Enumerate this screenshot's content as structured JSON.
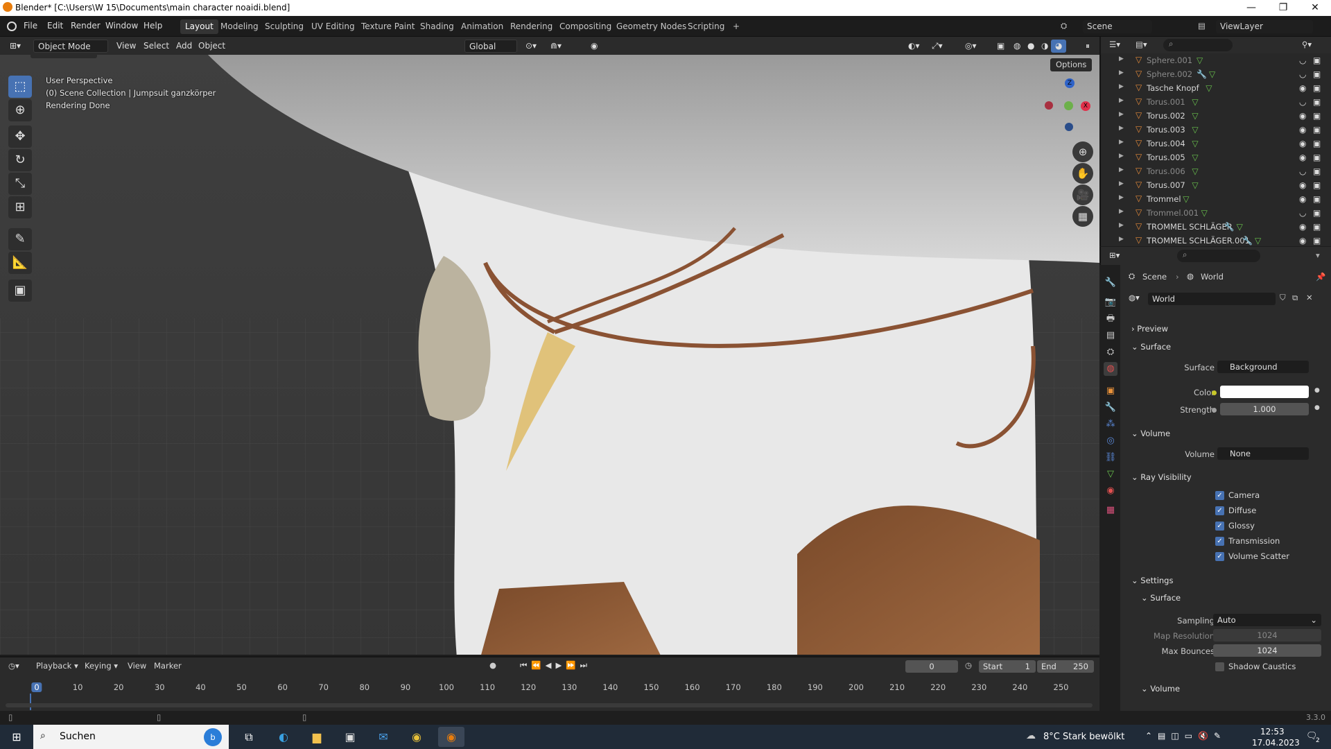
{
  "window": {
    "title": "Blender* [C:\\Users\\W 15\\Documents\\main character noaidi.blend]",
    "minimize": "—",
    "maximize": "❐",
    "close": "✕"
  },
  "menu": {
    "items": [
      "File",
      "Edit",
      "Render",
      "Window",
      "Help"
    ],
    "workspaces": [
      "Layout",
      "Modeling",
      "Sculpting",
      "UV Editing",
      "Texture Paint",
      "Shading",
      "Animation",
      "Rendering",
      "Compositing",
      "Geometry Nodes",
      "Scripting"
    ],
    "add_workspace": "+",
    "scene": "Scene",
    "view_layer": "ViewLayer"
  },
  "viewport_header": {
    "mode": "Object Mode",
    "menus": [
      "View",
      "Select",
      "Add",
      "Object"
    ],
    "orientation": "Global",
    "options": "Options"
  },
  "viewport": {
    "perspective": "User Perspective",
    "collection": "(0) Scene Collection | Jumpsuit ganzkörper",
    "status": "Rendering Done",
    "gizmo": {
      "z": "Z",
      "x": "X"
    }
  },
  "outliner": {
    "rows": [
      {
        "name": "Sphere.001",
        "dim": true,
        "modifier": false,
        "visible": false
      },
      {
        "name": "Sphere.002",
        "dim": true,
        "modifier": true,
        "visible": false
      },
      {
        "name": "Tasche Knopf",
        "dim": false,
        "modifier": false,
        "visible": true
      },
      {
        "name": "Torus.001",
        "dim": true,
        "modifier": false,
        "visible": false
      },
      {
        "name": "Torus.002",
        "dim": false,
        "modifier": false,
        "visible": true
      },
      {
        "name": "Torus.003",
        "dim": false,
        "modifier": false,
        "visible": true
      },
      {
        "name": "Torus.004",
        "dim": false,
        "modifier": false,
        "visible": true
      },
      {
        "name": "Torus.005",
        "dim": false,
        "modifier": false,
        "visible": true
      },
      {
        "name": "Torus.006",
        "dim": true,
        "modifier": false,
        "visible": false
      },
      {
        "name": "Torus.007",
        "dim": false,
        "modifier": false,
        "visible": true
      },
      {
        "name": "Trommel",
        "dim": false,
        "modifier": false,
        "visible": true
      },
      {
        "name": "Trommel.001",
        "dim": true,
        "modifier": false,
        "visible": false
      },
      {
        "name": "TROMMEL SCHLÄGER",
        "dim": false,
        "modifier": true,
        "visible": true
      },
      {
        "name": "TROMMEL SCHLÄGER.001",
        "dim": false,
        "modifier": true,
        "visible": true
      }
    ]
  },
  "properties": {
    "breadcrumb": {
      "scene": "Scene",
      "world": "World"
    },
    "world_name": "World",
    "sections": {
      "preview": "Preview",
      "surface": "Surface",
      "volume": "Volume",
      "ray_visibility": "Ray Visibility",
      "settings": "Settings",
      "settings_surface": "Surface",
      "settings_volume": "Volume"
    },
    "surface": {
      "label": "Surface",
      "value": "Background",
      "color_label": "Color",
      "color_value": "#ffffff",
      "strength_label": "Strength",
      "strength": "1.000"
    },
    "volume": {
      "label": "Volume",
      "value": "None"
    },
    "ray": [
      {
        "label": "Camera",
        "checked": true
      },
      {
        "label": "Diffuse",
        "checked": true
      },
      {
        "label": "Glossy",
        "checked": true
      },
      {
        "label": "Transmission",
        "checked": true
      },
      {
        "label": "Volume Scatter",
        "checked": true
      }
    ],
    "settings": {
      "sampling_label": "Sampling",
      "sampling": "Auto",
      "map_res_label": "Map Resolution",
      "map_res": "1024",
      "max_bounces_label": "Max Bounces",
      "max_bounces": "1024",
      "shadow_caustics": "Shadow Caustics"
    }
  },
  "timeline": {
    "menus": [
      "Playback",
      "Keying",
      "View",
      "Marker"
    ],
    "current_frame": "0",
    "start_label": "Start",
    "start": "1",
    "end_label": "End",
    "end": "250",
    "ticks": [
      "0",
      "10",
      "20",
      "30",
      "40",
      "50",
      "60",
      "70",
      "80",
      "90",
      "100",
      "110",
      "120",
      "130",
      "140",
      "150",
      "160",
      "170",
      "180",
      "190",
      "200",
      "210",
      "220",
      "230",
      "240",
      "250"
    ]
  },
  "status": {
    "version": "3.3.0"
  },
  "taskbar": {
    "search": "Suchen",
    "weather": "8°C  Stark bewölkt",
    "time": "12:53",
    "date": "17.04.2023",
    "notifications": "2"
  }
}
